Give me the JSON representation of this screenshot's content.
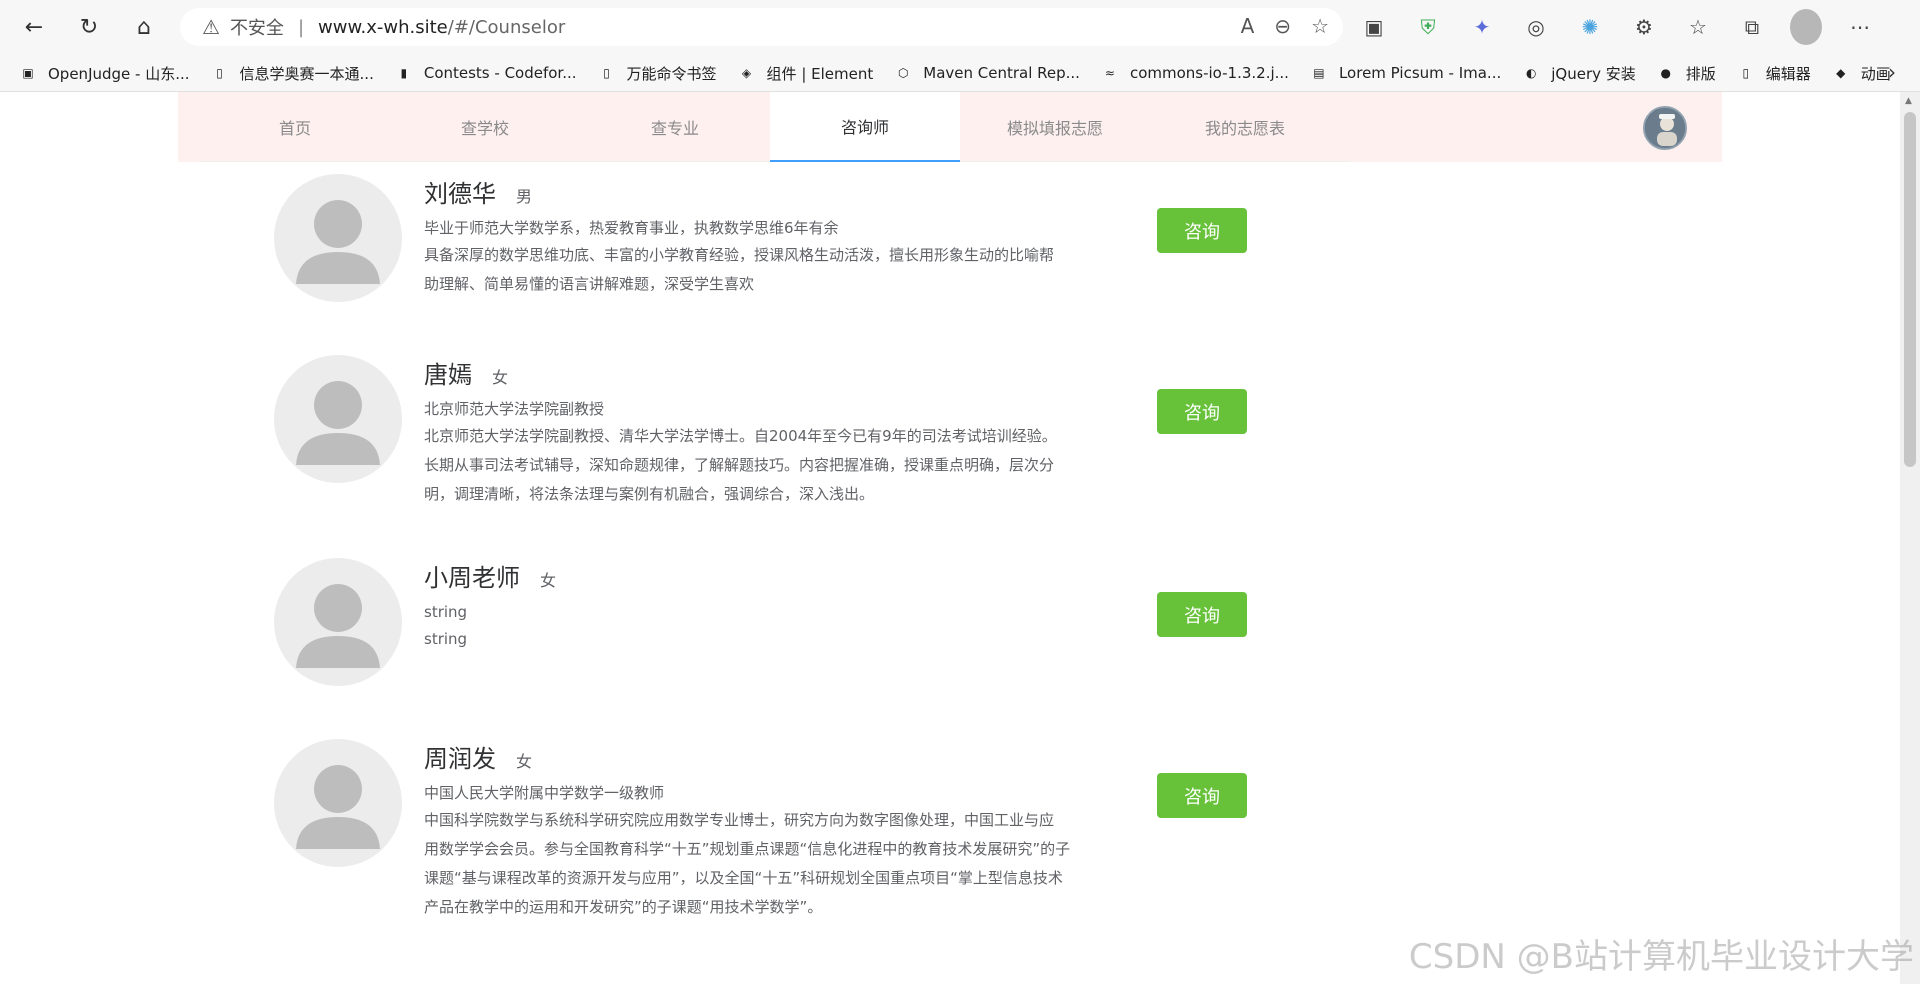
{
  "browser": {
    "insecure_label": "不安全",
    "url_host": "www.x-wh.site",
    "url_path": "/#/Counselor",
    "bookmarks": [
      {
        "label": "OpenJudge - 山东...",
        "icon": "poj-icon"
      },
      {
        "label": "信息学奥赛一本通...",
        "icon": "page-icon"
      },
      {
        "label": "Contests - Codefor...",
        "icon": "codeforces-icon"
      },
      {
        "label": "万能命令书签",
        "icon": "page-icon"
      },
      {
        "label": "组件 | Element",
        "icon": "element-icon"
      },
      {
        "label": "Maven Central Rep...",
        "icon": "maven-icon"
      },
      {
        "label": "commons-io-1.3.2.j...",
        "icon": "commons-icon"
      },
      {
        "label": "Lorem Picsum - Ima...",
        "icon": "image-icon"
      },
      {
        "label": "jQuery 安装",
        "icon": "jquery-icon"
      },
      {
        "label": "排版",
        "icon": "github-icon"
      },
      {
        "label": "编辑器",
        "icon": "page-icon"
      },
      {
        "label": "动画",
        "icon": "animation-icon"
      }
    ]
  },
  "nav": {
    "items": [
      {
        "label": "首页",
        "active": false
      },
      {
        "label": "查学校",
        "active": false
      },
      {
        "label": "查专业",
        "active": false
      },
      {
        "label": "咨询师",
        "active": true
      },
      {
        "label": "模拟填报志愿",
        "active": false
      },
      {
        "label": "我的志愿表",
        "active": false
      }
    ],
    "active_color": "#409eff"
  },
  "counselors": [
    {
      "name": "刘德华",
      "gender": "男",
      "title": "毕业于师范大学数学系，热爱教育事业，执教数学思维6年有余",
      "desc_lines": [
        "具备深厚的数学思维功底、丰富的小学教育经验，授课风格生动活泼，擅长用形象生动的比喻帮",
        "助理解、简单易懂的语言讲解难题，深受学生喜欢"
      ],
      "button": "咨询"
    },
    {
      "name": "唐嫣",
      "gender": "女",
      "title": "北京师范大学法学院副教授",
      "desc_lines": [
        "北京师范大学法学院副教授、清华大学法学博士。自2004年至今已有9年的司法考试培训经验。",
        "长期从事司法考试辅导，深知命题规律，了解解题技巧。内容把握准确，授课重点明确，层次分",
        "明，调理清晰，将法条法理与案例有机融合，强调综合，深入浅出。"
      ],
      "button": "咨询"
    },
    {
      "name": "小周老师",
      "gender": "女",
      "title": "string",
      "desc_lines": [
        "string"
      ],
      "button": "咨询"
    },
    {
      "name": "周润发",
      "gender": "女",
      "title": "中国人民大学附属中学数学一级教师",
      "desc_lines": [
        "中国科学院数学与系统科学研究院应用数学专业博士，研究方向为数字图像处理，中国工业与应",
        "用数学学会会员。参与全国教育科学“十五”规划重点课题“信息化进程中的教育技术发展研究”的子",
        "课题“基与课程改革的资源开发与应用”，以及全国“十五”科研规划全国重点项目“掌上型信息技术",
        "产品在教学中的运用和开发研究”的子课题“用技术学数学”。"
      ],
      "button": "咨询"
    }
  ],
  "button_color": "#67c23a",
  "watermark": "CSDN @B站计算机毕业设计大学"
}
